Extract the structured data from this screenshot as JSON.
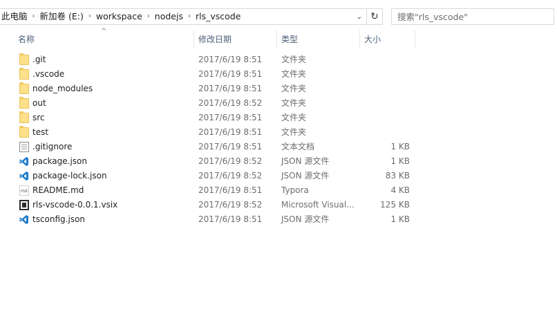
{
  "address": {
    "crumbs": [
      "此电脑",
      "新加卷 (E:)",
      "workspace",
      "nodejs",
      "rls_vscode"
    ],
    "separator": "›",
    "dropdown_glyph": "⌄",
    "refresh_glyph": "↻"
  },
  "search": {
    "placeholder": "搜索\"rls_vscode\""
  },
  "columns": {
    "name": "名称",
    "date": "修改日期",
    "type": "类型",
    "size": "大小",
    "sort_glyph": "^"
  },
  "files": [
    {
      "name": ".git",
      "date": "2017/6/19 8:51",
      "type": "文件夹",
      "size": "",
      "icon": "folder-icon"
    },
    {
      "name": ".vscode",
      "date": "2017/6/19 8:51",
      "type": "文件夹",
      "size": "",
      "icon": "folder-icon"
    },
    {
      "name": "node_modules",
      "date": "2017/6/19 8:51",
      "type": "文件夹",
      "size": "",
      "icon": "folder-icon"
    },
    {
      "name": "out",
      "date": "2017/6/19 8:52",
      "type": "文件夹",
      "size": "",
      "icon": "folder-icon"
    },
    {
      "name": "src",
      "date": "2017/6/19 8:51",
      "type": "文件夹",
      "size": "",
      "icon": "folder-icon"
    },
    {
      "name": "test",
      "date": "2017/6/19 8:51",
      "type": "文件夹",
      "size": "",
      "icon": "folder-icon"
    },
    {
      "name": ".gitignore",
      "date": "2017/6/19 8:51",
      "type": "文本文档",
      "size": "1 KB",
      "icon": "text-file-icon"
    },
    {
      "name": "package.json",
      "date": "2017/6/19 8:52",
      "type": "JSON 源文件",
      "size": "1 KB",
      "icon": "vscode-file-icon"
    },
    {
      "name": "package-lock.json",
      "date": "2017/6/19 8:52",
      "type": "JSON 源文件",
      "size": "83 KB",
      "icon": "vscode-file-icon"
    },
    {
      "name": "README.md",
      "date": "2017/6/19 8:51",
      "type": "Typora",
      "size": "4 KB",
      "icon": "markdown-file-icon"
    },
    {
      "name": "rls-vscode-0.0.1.vsix",
      "date": "2017/6/19 8:52",
      "type": "Microsoft Visual...",
      "size": "125 KB",
      "icon": "vsix-file-icon"
    },
    {
      "name": "tsconfig.json",
      "date": "2017/6/19 8:51",
      "type": "JSON 源文件",
      "size": "1 KB",
      "icon": "vscode-file-icon"
    }
  ],
  "colors": {
    "folder": "#ffe08a",
    "vscode_blue": "#1f7acc",
    "header_text": "#4c607a",
    "muted_text": "#6d6d6d"
  }
}
